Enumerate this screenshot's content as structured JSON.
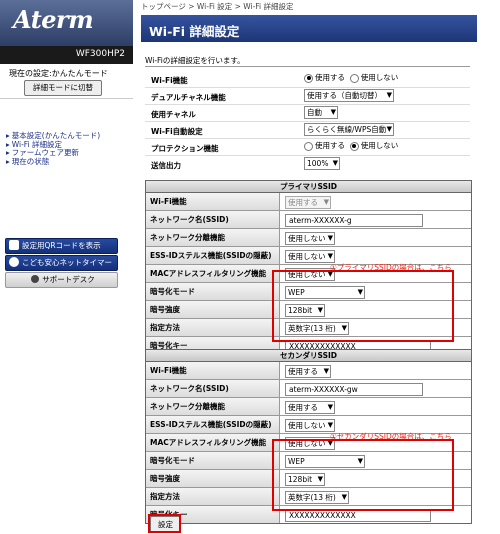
{
  "brand": {
    "logo": "Aterm",
    "model": "WF300HP2"
  },
  "mode": {
    "text": "現在の設定:かんたんモード",
    "button": "詳細モードに切替"
  },
  "nav": [
    "基本設定(かんたんモード)",
    "Wi-Fi 詳細設定",
    "ファームウェア更新",
    "現在の状態"
  ],
  "side_buttons": {
    "qr": "設定用QRコードを表示",
    "timer": "こども安心ネットタイマー",
    "support": "サポートデスク"
  },
  "breadcrumb": "トップページ > Wi-Fi 設定 > Wi-Fi 詳細設定",
  "page_title": "Wi-Fi 詳細設定",
  "description": "Wi-Fiの詳細設定を行います。",
  "basic": {
    "wifi_label": "Wi-Fi機能",
    "use": "使用する",
    "not_use": "使用しない",
    "dual_label": "デュアルチャネル機能",
    "dual_value": "使用する（自動切替）",
    "channel_label": "使用チャネル",
    "channel_value": "自動",
    "auto_label": "Wi-Fi自動設定",
    "auto_value": "らくらく無線/WPS自動",
    "protect_label": "プロテクション機能",
    "power_label": "送信出力",
    "power_value": "100%"
  },
  "primary": {
    "header": "プライマリSSID",
    "rows": [
      {
        "label": "Wi-Fi機能",
        "value": "使用する"
      },
      {
        "label": "ネットワーク名(SSID)",
        "value": "aterm-XXXXXX-g"
      },
      {
        "label": "ネットワーク分離機能",
        "value": "使用しない"
      },
      {
        "label": "ESS-IDステルス機能(SSIDの隠蔽)",
        "value": "使用しない"
      },
      {
        "label": "MACアドレスフィルタリング機能",
        "value": "使用しない"
      },
      {
        "label": "暗号化モード",
        "value": "WEP"
      },
      {
        "label": "暗号強度",
        "value": "128bit"
      },
      {
        "label": "指定方法",
        "value": "英数字(13 桁)"
      },
      {
        "label": "暗号化キー",
        "value": "XXXXXXXXXXXXX"
      }
    ],
    "note": "①プライマリSSIDの場合は、こちら"
  },
  "secondary": {
    "header": "セカンダリSSID",
    "rows": [
      {
        "label": "Wi-Fi機能",
        "value": "使用する"
      },
      {
        "label": "ネットワーク名(SSID)",
        "value": "aterm-XXXXXX-gw"
      },
      {
        "label": "ネットワーク分離機能",
        "value": "使用する"
      },
      {
        "label": "ESS-IDステルス機能(SSIDの隠蔽)",
        "value": "使用しない"
      },
      {
        "label": "MACアドレスフィルタリング機能",
        "value": "使用しない"
      },
      {
        "label": "暗号化モード",
        "value": "WEP"
      },
      {
        "label": "暗号強度",
        "value": "128bit"
      },
      {
        "label": "指定方法",
        "value": "英数字(13 桁)"
      },
      {
        "label": "暗号化キー",
        "value": "XXXXXXXXXXXXX"
      }
    ],
    "note": "①セカンダリSSIDの場合は、こちら"
  },
  "submit": "設定",
  "colors": {
    "accent": "#1d3576",
    "highlight": "#e00000"
  }
}
